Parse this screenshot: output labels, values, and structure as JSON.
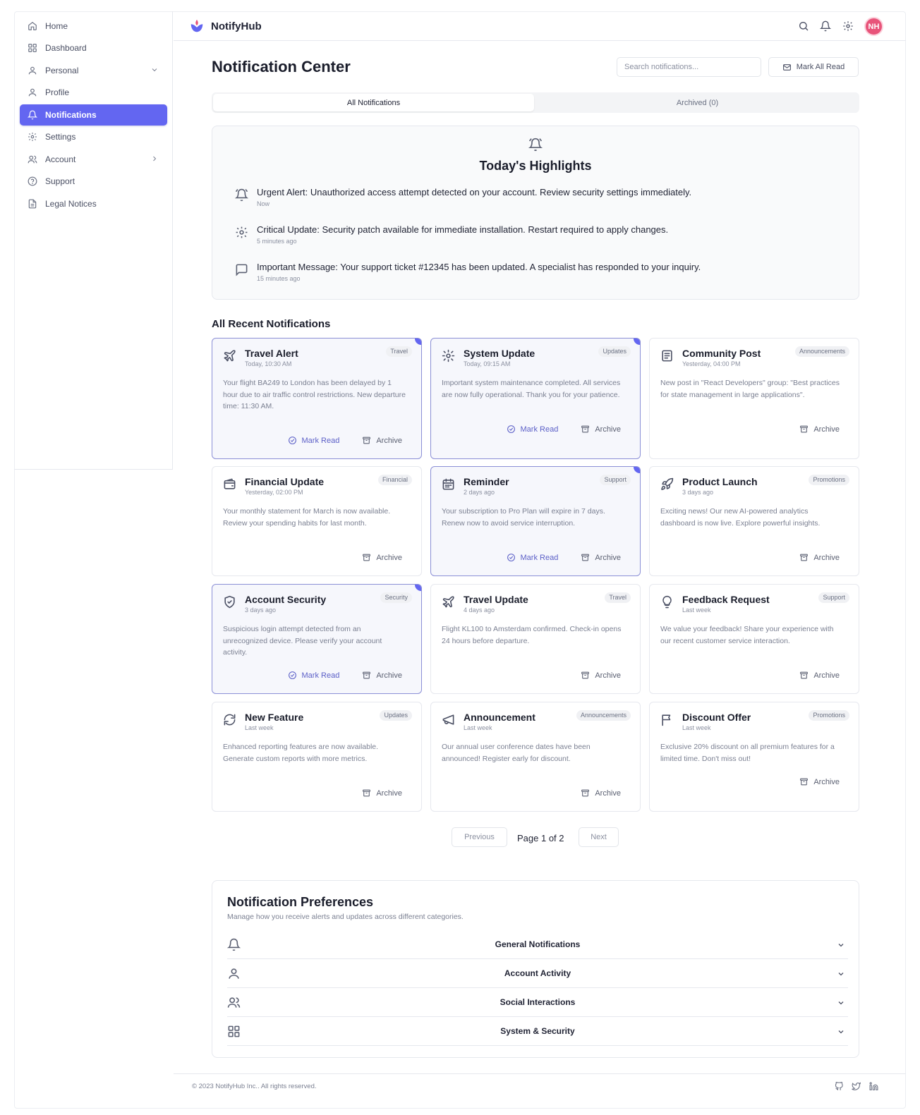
{
  "app": {
    "brand": "NotifyHub",
    "avatar_initials": "NH",
    "accent_color": "#6366f1",
    "avatar_color": "#e8547a"
  },
  "sidebar": {
    "items": [
      {
        "label": "Home",
        "icon": "home-icon"
      },
      {
        "label": "Dashboard",
        "icon": "dashboard-icon"
      },
      {
        "label": "Personal",
        "icon": "user-icon",
        "chevron": "down"
      },
      {
        "label": "Profile",
        "icon": "user-icon"
      },
      {
        "label": "Notifications",
        "icon": "bell-icon",
        "active": true
      },
      {
        "label": "Settings",
        "icon": "gear-icon"
      },
      {
        "label": "Account",
        "icon": "users-icon",
        "chevron": "right"
      },
      {
        "label": "Support",
        "icon": "help-icon"
      },
      {
        "label": "Legal Notices",
        "icon": "document-icon"
      }
    ]
  },
  "header": {
    "title": "Notification Center",
    "search_placeholder": "Search notifications...",
    "mark_all_label": "Mark All Read"
  },
  "tabs": [
    {
      "label": "All Notifications",
      "active": true
    },
    {
      "label": "Archived (0)",
      "active": false
    }
  ],
  "highlights": {
    "title": "Today's Highlights",
    "items": [
      {
        "icon": "alarm-icon",
        "text": "Urgent Alert: Unauthorized access attempt detected on your account. Review security settings immediately.",
        "time": "Now"
      },
      {
        "icon": "gear-icon",
        "text": "Critical Update: Security patch available for immediate installation. Restart required to apply changes.",
        "time": "5 minutes ago"
      },
      {
        "icon": "message-icon",
        "text": "Important Message: Your support ticket #12345 has been updated. A specialist has responded to your inquiry.",
        "time": "15 minutes ago"
      }
    ]
  },
  "recent": {
    "title": "All Recent Notifications",
    "mark_read_label": "Mark Read",
    "archive_label": "Archive",
    "cards": [
      {
        "icon": "plane-icon",
        "title": "Travel Alert",
        "time": "Today, 10:30 AM",
        "badge": "Travel",
        "unread": true,
        "body": "Your flight BA249 to London has been delayed by 1 hour due to air traffic control restrictions. New departure time: 11:30 AM."
      },
      {
        "icon": "gear-icon",
        "title": "System Update",
        "time": "Today, 09:15 AM",
        "badge": "Updates",
        "unread": true,
        "body": "Important system maintenance completed. All services are now fully operational. Thank you for your patience."
      },
      {
        "icon": "document-icon",
        "title": "Community Post",
        "time": "Yesterday, 04:00 PM",
        "badge": "Announcements",
        "unread": false,
        "body": "New post in \"React Developers\" group: \"Best practices for state management in large applications\"."
      },
      {
        "icon": "wallet-icon",
        "title": "Financial Update",
        "time": "Yesterday, 02:00 PM",
        "badge": "Financial",
        "unread": false,
        "body": "Your monthly statement for March is now available. Review your spending habits for last month."
      },
      {
        "icon": "calendar-icon",
        "title": "Reminder",
        "time": "2 days ago",
        "badge": "Support",
        "unread": true,
        "body": "Your subscription to Pro Plan will expire in 7 days. Renew now to avoid service interruption."
      },
      {
        "icon": "rocket-icon",
        "title": "Product Launch",
        "time": "3 days ago",
        "badge": "Promotions",
        "unread": false,
        "body": "Exciting news! Our new AI-powered analytics dashboard is now live. Explore powerful insights."
      },
      {
        "icon": "shield-icon",
        "title": "Account Security",
        "time": "3 days ago",
        "badge": "Security",
        "unread": true,
        "body": "Suspicious login attempt detected from an unrecognized device. Please verify your account activity."
      },
      {
        "icon": "plane-icon",
        "title": "Travel Update",
        "time": "4 days ago",
        "badge": "Travel",
        "unread": false,
        "body": "Flight KL100 to Amsterdam confirmed. Check-in opens 24 hours before departure."
      },
      {
        "icon": "lightbulb-icon",
        "title": "Feedback Request",
        "time": "Last week",
        "badge": "Support",
        "unread": false,
        "body": "We value your feedback! Share your experience with our recent customer service interaction."
      },
      {
        "icon": "refresh-icon",
        "title": "New Feature",
        "time": "Last week",
        "badge": "Updates",
        "unread": false,
        "body": "Enhanced reporting features are now available. Generate custom reports with more metrics."
      },
      {
        "icon": "megaphone-icon",
        "title": "Announcement",
        "time": "Last week",
        "badge": "Announcements",
        "unread": false,
        "body": "Our annual user conference dates have been announced! Register early for discount."
      },
      {
        "icon": "flag-icon",
        "title": "Discount Offer",
        "time": "Last week",
        "badge": "Promotions",
        "unread": false,
        "body": "Exclusive 20% discount on all premium features for a limited time. Don't miss out!"
      }
    ]
  },
  "pagination": {
    "previous": "Previous",
    "page_text": "Page 1 of 2",
    "next": "Next"
  },
  "preferences": {
    "title": "Notification Preferences",
    "subtitle": "Manage how you receive alerts and updates across different categories.",
    "rows": [
      {
        "icon": "bell-icon",
        "label": "General Notifications"
      },
      {
        "icon": "user-icon",
        "label": "Account Activity"
      },
      {
        "icon": "users-icon",
        "label": "Social Interactions"
      },
      {
        "icon": "grid-icon",
        "label": "System & Security"
      }
    ]
  },
  "footer": {
    "copyright": "© 2023 NotifyHub Inc.. All rights reserved.",
    "social": [
      "github-icon",
      "twitter-icon",
      "linkedin-icon"
    ]
  }
}
